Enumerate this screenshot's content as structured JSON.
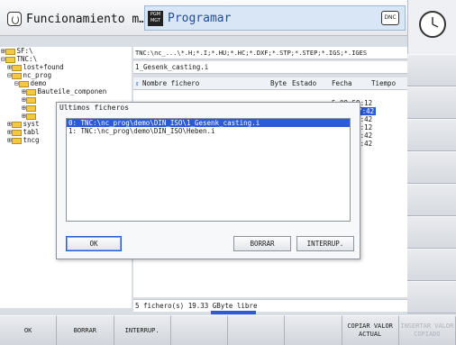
{
  "header": {
    "mode_tab": "Funcionamiento m…",
    "active_tab": "Programar",
    "pgm_icon_text": "PGM MGT",
    "dnc_label": "DNC"
  },
  "tree": [
    "SF:\\",
    "TNC:\\",
    "lost+found",
    "nc_prog",
    "demo",
    "Bauteile_componen",
    "",
    "",
    "",
    "syst",
    "tabl",
    "tncg"
  ],
  "path": "TNC:\\nc_...\\*.H;*.I;*.HU;*.HC;*.DXF;*.STP;*.STEP;*.IGS;*.IGES",
  "filter": "1_Gesenk_casting.i",
  "columns": {
    "name": "Nombre fichero",
    "size": "Byte",
    "status": "Estado",
    "date": "Fecha",
    "time": "Tiempo"
  },
  "file_times": [
    "5 08:59:12",
    "5 01:47:42",
    "5 01:47:42",
    "5 08:59:12",
    "5 01:47:42",
    "5 01:47:42"
  ],
  "status_text": "5   fichero(s)   19.33 GByte libre",
  "dialog": {
    "title": "Ultimos ficheros",
    "items": [
      "0: TNC:\\nc_prog\\demo\\DIN_ISO\\1_Gesenk_casting.i",
      "1: TNC:\\nc_prog\\demo\\DIN_ISO\\Heben.i"
    ],
    "ok": "OK",
    "delete": "BORRAR",
    "cancel": "INTERRUP."
  },
  "softkeys": {
    "ok": "OK",
    "delete": "BORRAR",
    "cancel": "INTERRUP.",
    "copy": "COPIAR VALOR ACTUAL",
    "insert": "INSERTAR VALOR COPIADO"
  },
  "colors": {
    "selection": "#2b5bd6",
    "folder": "#f2c940",
    "active_tab": "#d8e6f6"
  }
}
